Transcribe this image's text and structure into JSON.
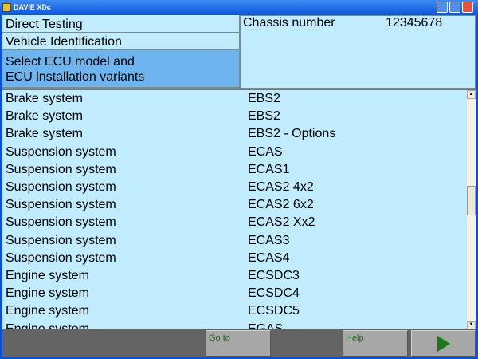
{
  "window": {
    "title": "DAVIE XDc"
  },
  "nav": {
    "items": [
      {
        "label": "Direct Testing"
      },
      {
        "label": "Vehicle Identification"
      },
      {
        "label": "Select ECU model and\nECU installation variants"
      }
    ]
  },
  "info": {
    "chassis_label": "Chassis number",
    "chassis_value": "12345678"
  },
  "list": {
    "rows": [
      [
        "Brake system",
        "EBS2"
      ],
      [
        "Brake system",
        "EBS2"
      ],
      [
        "Brake system",
        "EBS2 - Options"
      ],
      [
        "Suspension system",
        "ECAS"
      ],
      [
        "Suspension system",
        "ECAS1"
      ],
      [
        "Suspension system",
        "ECAS2 4x2"
      ],
      [
        "Suspension system",
        "ECAS2 6x2"
      ],
      [
        "Suspension system",
        "ECAS2 Xx2"
      ],
      [
        "Suspension system",
        "ECAS3"
      ],
      [
        "Suspension system",
        "ECAS4"
      ],
      [
        "Engine system",
        "ECSDC3"
      ],
      [
        "Engine system",
        "ECSDC4"
      ],
      [
        "Engine system",
        "ECSDC5"
      ],
      [
        "Engine system",
        "EGAS"
      ]
    ]
  },
  "toolbar": {
    "goto_label": "Go to",
    "help_label": "Help",
    "next_icon": "play-arrow-icon",
    "accent": "#1a7a1a"
  }
}
